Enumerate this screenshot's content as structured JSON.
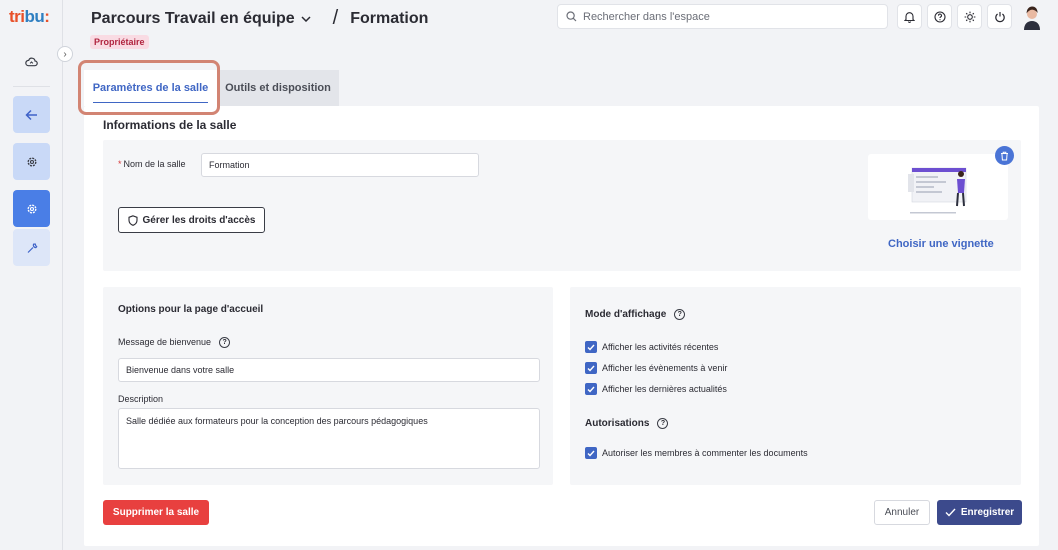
{
  "app": {
    "logo_main": "tri",
    "logo_accent": "bu",
    "logo_suffix": ":"
  },
  "header": {
    "breadcrumb_parent": "Parcours Travail en équipe",
    "breadcrumb_current": "Formation",
    "role_badge": "Propriétaire",
    "search_placeholder": "Rechercher dans l'espace"
  },
  "tabs": [
    {
      "label": "Paramètres de la salle",
      "active": true
    },
    {
      "label": "Outils et disposition",
      "active": false
    }
  ],
  "info": {
    "title": "Informations de la salle",
    "name_label": "Nom de la salle",
    "name_required_mark": "*",
    "name_value": "Formation",
    "rights_button": "Gérer les droits d'accès",
    "thumbnail_link": "Choisir une vignette"
  },
  "options": {
    "title": "Options pour la page d'accueil",
    "welcome_label": "Message de bienvenue",
    "welcome_value": "Bienvenue dans votre salle",
    "description_label": "Description",
    "description_value": "Salle dédiée aux formateurs pour la conception des parcours pédagogiques"
  },
  "display_mode": {
    "title": "Mode d'affichage",
    "items": [
      {
        "label": "Afficher les activités récentes",
        "checked": true
      },
      {
        "label": "Afficher les évènements à venir",
        "checked": true
      },
      {
        "label": "Afficher les dernières actualités",
        "checked": true
      }
    ]
  },
  "permissions": {
    "title": "Autorisations",
    "items": [
      {
        "label": "Autoriser les membres à commenter les documents",
        "checked": true
      }
    ]
  },
  "footer": {
    "delete_button": "Supprimer la salle",
    "cancel_button": "Annuler",
    "save_button": "Enregistrer"
  },
  "colors": {
    "accent": "#3f66c4",
    "danger": "#e8403f",
    "save": "#3c4a8c",
    "highlight": "#d28473"
  }
}
